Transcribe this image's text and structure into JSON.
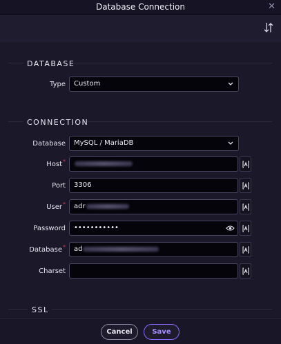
{
  "window": {
    "title": "Database Connection",
    "close_glyph": "✕"
  },
  "sections": {
    "database": {
      "title": "DATABASE"
    },
    "connection": {
      "title": "CONNECTION"
    },
    "ssl": {
      "title": "SSL"
    }
  },
  "fields": {
    "type": {
      "label": "Type",
      "value": "Custom"
    },
    "db_engine": {
      "label": "Database",
      "value": "MySQL / MariaDB"
    },
    "host": {
      "label": "Host",
      "required": "*",
      "value": ""
    },
    "port": {
      "label": "Port",
      "value": "3306"
    },
    "user": {
      "label": "User",
      "required": "*",
      "value": "adr"
    },
    "password": {
      "label": "Password",
      "value": "•••••••••••"
    },
    "database_name": {
      "label": "Database",
      "required": "*",
      "value": "ad"
    },
    "charset": {
      "label": "Charset",
      "value": ""
    }
  },
  "footer": {
    "cancel_label": "Cancel",
    "save_label": "Save"
  },
  "colors": {
    "accent": "#8b6bff",
    "required": "#d83a5f",
    "background": "#1b1929"
  },
  "icons": [
    "close-icon",
    "sort-icon",
    "chevron-down-icon",
    "eye-icon",
    "variable-key-icon"
  ]
}
